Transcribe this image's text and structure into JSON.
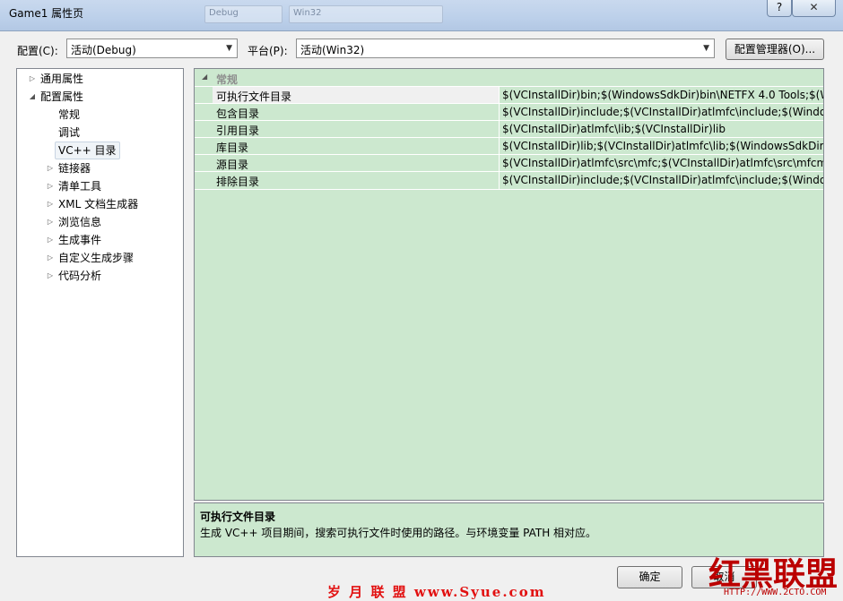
{
  "window": {
    "title": "Game1 属性页",
    "help_label": "?",
    "close_label": "✕",
    "ghost_texts": [
      "Debug",
      "Win32"
    ]
  },
  "toolbar": {
    "config_label": "配置(C):",
    "config_value": "活动(Debug)",
    "platform_label": "平台(P):",
    "platform_value": "活动(Win32)",
    "config_manager_label": "配置管理器(O)..."
  },
  "tree": {
    "items": [
      {
        "label": "通用属性",
        "expand": "▷"
      },
      {
        "label": "配置属性",
        "expand": "◢"
      },
      {
        "label": "常规"
      },
      {
        "label": "调试"
      },
      {
        "label": "VC++ 目录",
        "selected": true
      },
      {
        "label": "链接器",
        "expand": "▷"
      },
      {
        "label": "清单工具",
        "expand": "▷"
      },
      {
        "label": "XML 文档生成器",
        "expand": "▷"
      },
      {
        "label": "浏览信息",
        "expand": "▷"
      },
      {
        "label": "生成事件",
        "expand": "▷"
      },
      {
        "label": "自定义生成步骤",
        "expand": "▷"
      },
      {
        "label": "代码分析",
        "expand": "▷"
      }
    ]
  },
  "grid": {
    "category": "常规",
    "rows": [
      {
        "name": "可执行文件目录",
        "value": "$(VCInstallDir)bin;$(WindowsSdkDir)bin\\NETFX 4.0 Tools;$(Wi"
      },
      {
        "name": "包含目录",
        "value": "$(VCInstallDir)include;$(VCInstallDir)atlmfc\\include;$(WindowsS"
      },
      {
        "name": "引用目录",
        "value": "$(VCInstallDir)atlmfc\\lib;$(VCInstallDir)lib"
      },
      {
        "name": "库目录",
        "value": "$(VCInstallDir)lib;$(VCInstallDir)atlmfc\\lib;$(WindowsSdkDir)lib"
      },
      {
        "name": "源目录",
        "value": "$(VCInstallDir)atlmfc\\src\\mfc;$(VCInstallDir)atlmfc\\src\\mfcm;$("
      },
      {
        "name": "排除目录",
        "value": "$(VCInstallDir)include;$(VCInstallDir)atlmfc\\include;$(WindowsS"
      }
    ]
  },
  "description": {
    "title": "可执行文件目录",
    "text": "生成 VC++ 项目期间，搜索可执行文件时使用的路径。与环境变量 PATH 相对应。"
  },
  "buttons": {
    "ok_label": "确定",
    "cancel_label": "取消"
  },
  "watermark": {
    "left": "岁 月 联 盟  www.Syue.com",
    "right": "红黑联盟",
    "right_url": "HTTP://WWW.2CTO.COM"
  }
}
